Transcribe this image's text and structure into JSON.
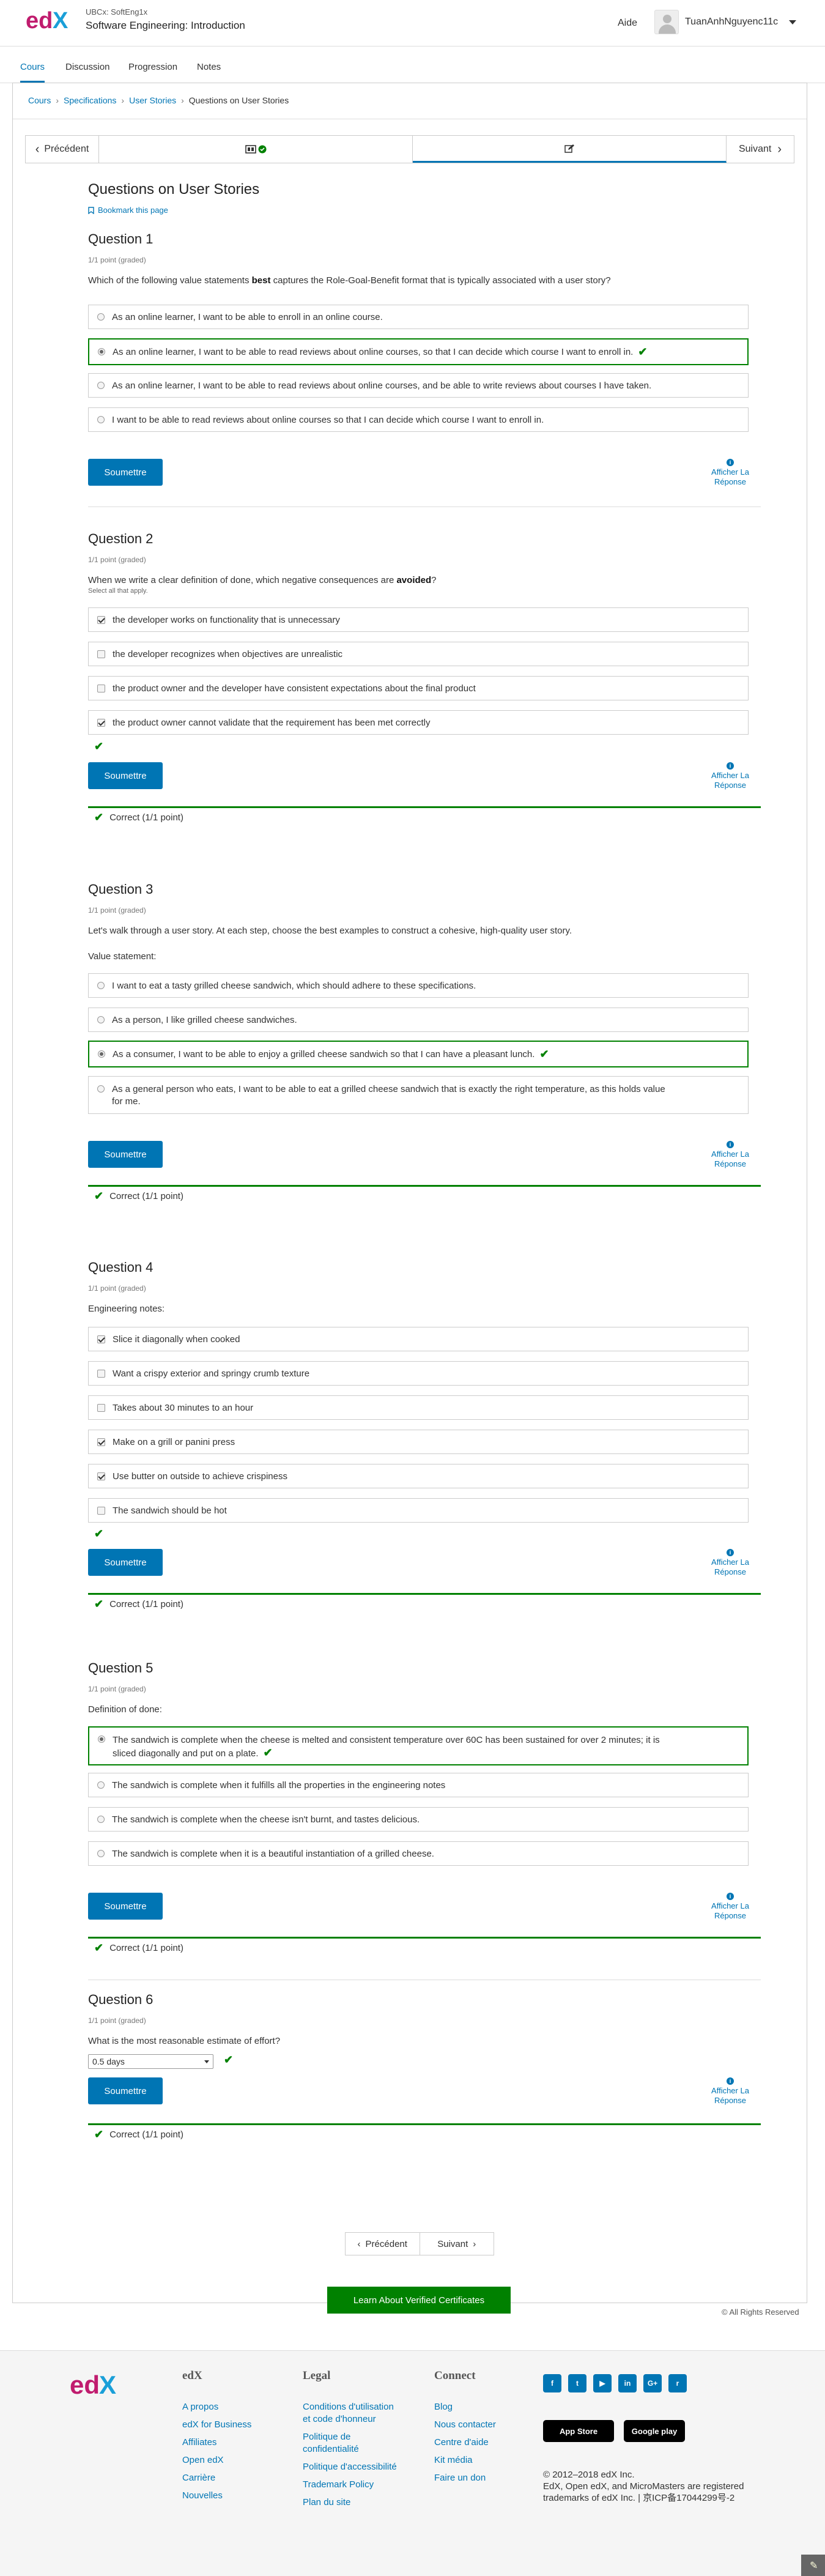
{
  "header": {
    "course_org": "UBCx: SoftEng1x",
    "course_title": "Software Engineering: Introduction",
    "help": "Aide",
    "username": "TuanAnhNguyenc11c"
  },
  "tabs": [
    "Cours",
    "Discussion",
    "Progression",
    "Notes"
  ],
  "breadcrumb": [
    "Cours",
    "Specifications",
    "User Stories",
    "Questions on User Stories"
  ],
  "seqnav": {
    "prev": "Précédent",
    "next": "Suivant"
  },
  "page": {
    "title": "Questions on User Stories",
    "bookmark": "Bookmark this page"
  },
  "common": {
    "submit": "Soumettre",
    "show_answer": "Afficher La Réponse",
    "correct": "Correct (1/1 point)",
    "points": "1/1 point (graded)"
  },
  "q1": {
    "title": "Question 1",
    "prompt_a": "Which of the following value statements ",
    "prompt_b": "best",
    "prompt_c": " captures the Role-Goal-Benefit format that is typically associated with a user story?",
    "choices": [
      "As an online learner, I want to be able to enroll in an online course.",
      "As an online learner, I want to be able to read reviews about online courses, so that I can decide which course I want to enroll in.",
      "As an online learner, I want to be able to read reviews about online courses, and be able to write reviews about courses I have taken.",
      "I want to be able to read reviews about online courses so that I can decide which course I want to enroll in."
    ]
  },
  "q2": {
    "title": "Question 2",
    "prompt_a": "When we write a clear definition of done, which negative consequences are ",
    "prompt_b": "avoided",
    "prompt_c": "?",
    "sub": "Select all that apply.",
    "choices": [
      "the developer works on functionality that is unnecessary",
      "the developer recognizes when objectives are unrealistic",
      "the product owner and the developer have consistent expectations about the final product",
      "the product owner cannot validate that the requirement has been met correctly"
    ]
  },
  "q3": {
    "title": "Question 3",
    "prompt": "Let's walk through a user story. At each step, choose the best examples to construct a cohesive, high-quality user story.",
    "label": "Value statement:",
    "choices": [
      "I want to eat a tasty grilled cheese sandwich, which should adhere to these specifications.",
      "As a person, I like grilled cheese sandwiches.",
      "As a consumer, I want to be able to enjoy a grilled cheese sandwich so that I can have a pleasant lunch.",
      "As a general person who eats, I want to be able to eat a grilled cheese sandwich that is exactly the right temperature, as this holds value",
      "for me."
    ]
  },
  "q4": {
    "title": "Question 4",
    "label": "Engineering notes:",
    "choices": [
      "Slice it diagonally when cooked",
      "Want a crispy exterior and springy crumb texture",
      "Takes about 30 minutes to an hour",
      "Make on a grill or panini press",
      "Use butter on outside to achieve crispiness",
      "The sandwich should be hot"
    ]
  },
  "q5": {
    "title": "Question 5",
    "label": "Definition of done:",
    "choices": [
      "The sandwich is complete when the cheese is melted and consistent temperature over 60C has been sustained for over 2 minutes; it is",
      "sliced diagonally and put on a plate.",
      "The sandwich is complete when it fulfills all the properties in the engineering notes",
      "The sandwich is complete when the cheese isn't burnt, and tastes delicious.",
      "The sandwich is complete when it is a beautiful instantiation of a grilled cheese."
    ]
  },
  "q6": {
    "title": "Question 6",
    "prompt": "What is the most reasonable estimate of effort?",
    "selected": "0.5 days"
  },
  "bottom_nav": {
    "prev": "Précédent",
    "next": "Suivant"
  },
  "cert_button": "Learn About Verified Certificates",
  "rights": "© All Rights Reserved",
  "footer": {
    "edx": {
      "heading": "edX",
      "links": [
        "A propos",
        "edX for Business",
        "Affiliates",
        "Open edX",
        "Carrière",
        "Nouvelles"
      ]
    },
    "legal": {
      "heading": "Legal",
      "links": [
        "Conditions d'utilisation et code d'honneur",
        "Politique de confidentialité",
        "Politique d'accessibilité",
        "Trademark Policy",
        "Plan du site"
      ]
    },
    "connect": {
      "heading": "Connect",
      "links": [
        "Blog",
        "Nous contacter",
        "Centre d'aide",
        "Kit média",
        "Faire un don"
      ]
    },
    "stores": [
      "App Store",
      "Google play"
    ],
    "copyright": "© 2012–2018 edX Inc.",
    "trademark": "EdX, Open edX, and MicroMasters are registered trademarks of edX Inc. | 京ICP备17044299号-2"
  }
}
